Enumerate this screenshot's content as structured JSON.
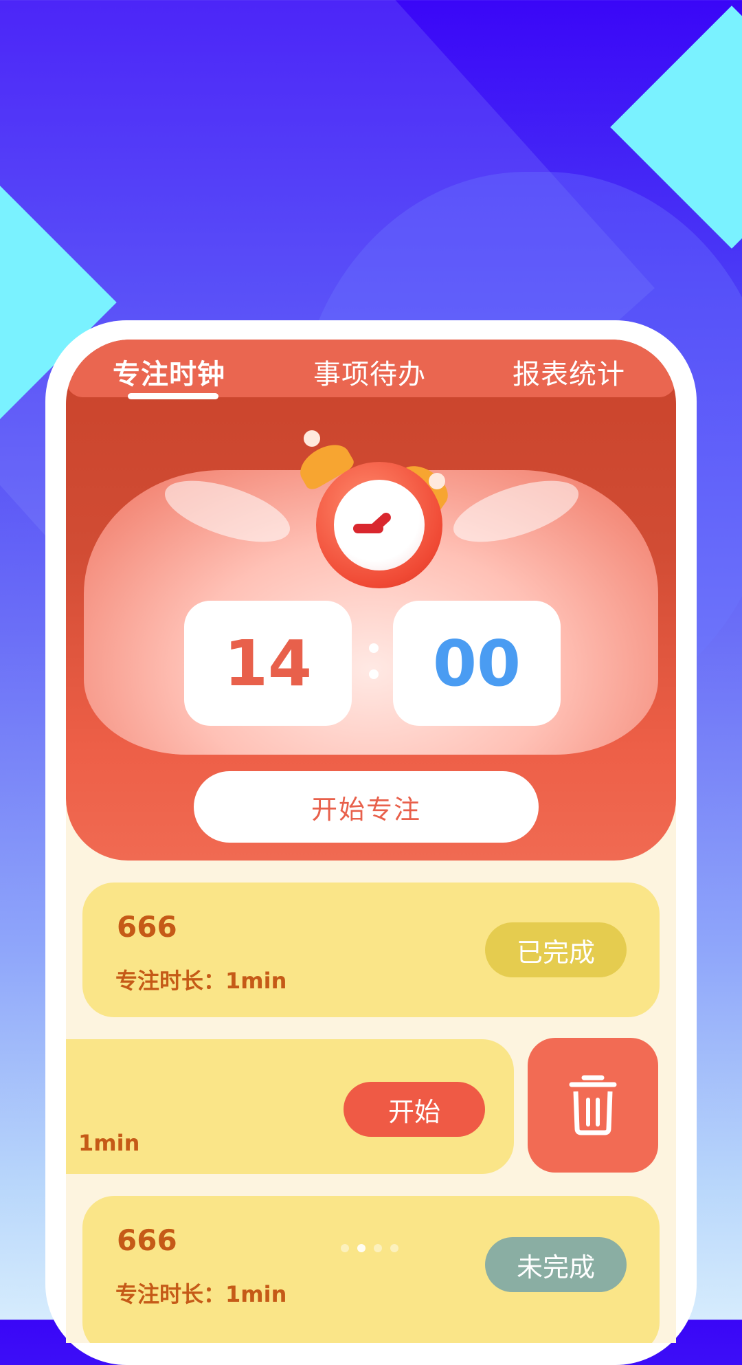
{
  "tabs": [
    {
      "label": "专注时钟",
      "active": true
    },
    {
      "label": "事项待办",
      "active": false
    },
    {
      "label": "报表统计",
      "active": false
    }
  ],
  "timer": {
    "minutes": "14",
    "seconds": "00"
  },
  "start_focus_label": "开始专注",
  "tasks": [
    {
      "title": "666",
      "duration": "专注时长：1min",
      "status": "已完成",
      "status_color": "#e5cc4f"
    },
    {
      "title": "",
      "duration": "：1min",
      "status": "开始",
      "status_color": "#ef5a45",
      "swiped": true
    },
    {
      "title": "666",
      "duration": "专注时长：1min",
      "status": "未完成",
      "status_color": "#8aaea3"
    }
  ],
  "icons": {
    "delete": "trash-icon",
    "clock": "alarm-clock-icon"
  },
  "colors": {
    "accent": "#e8604b",
    "minutes_color": "#4a9cf2",
    "card_bg": "#fae588"
  }
}
